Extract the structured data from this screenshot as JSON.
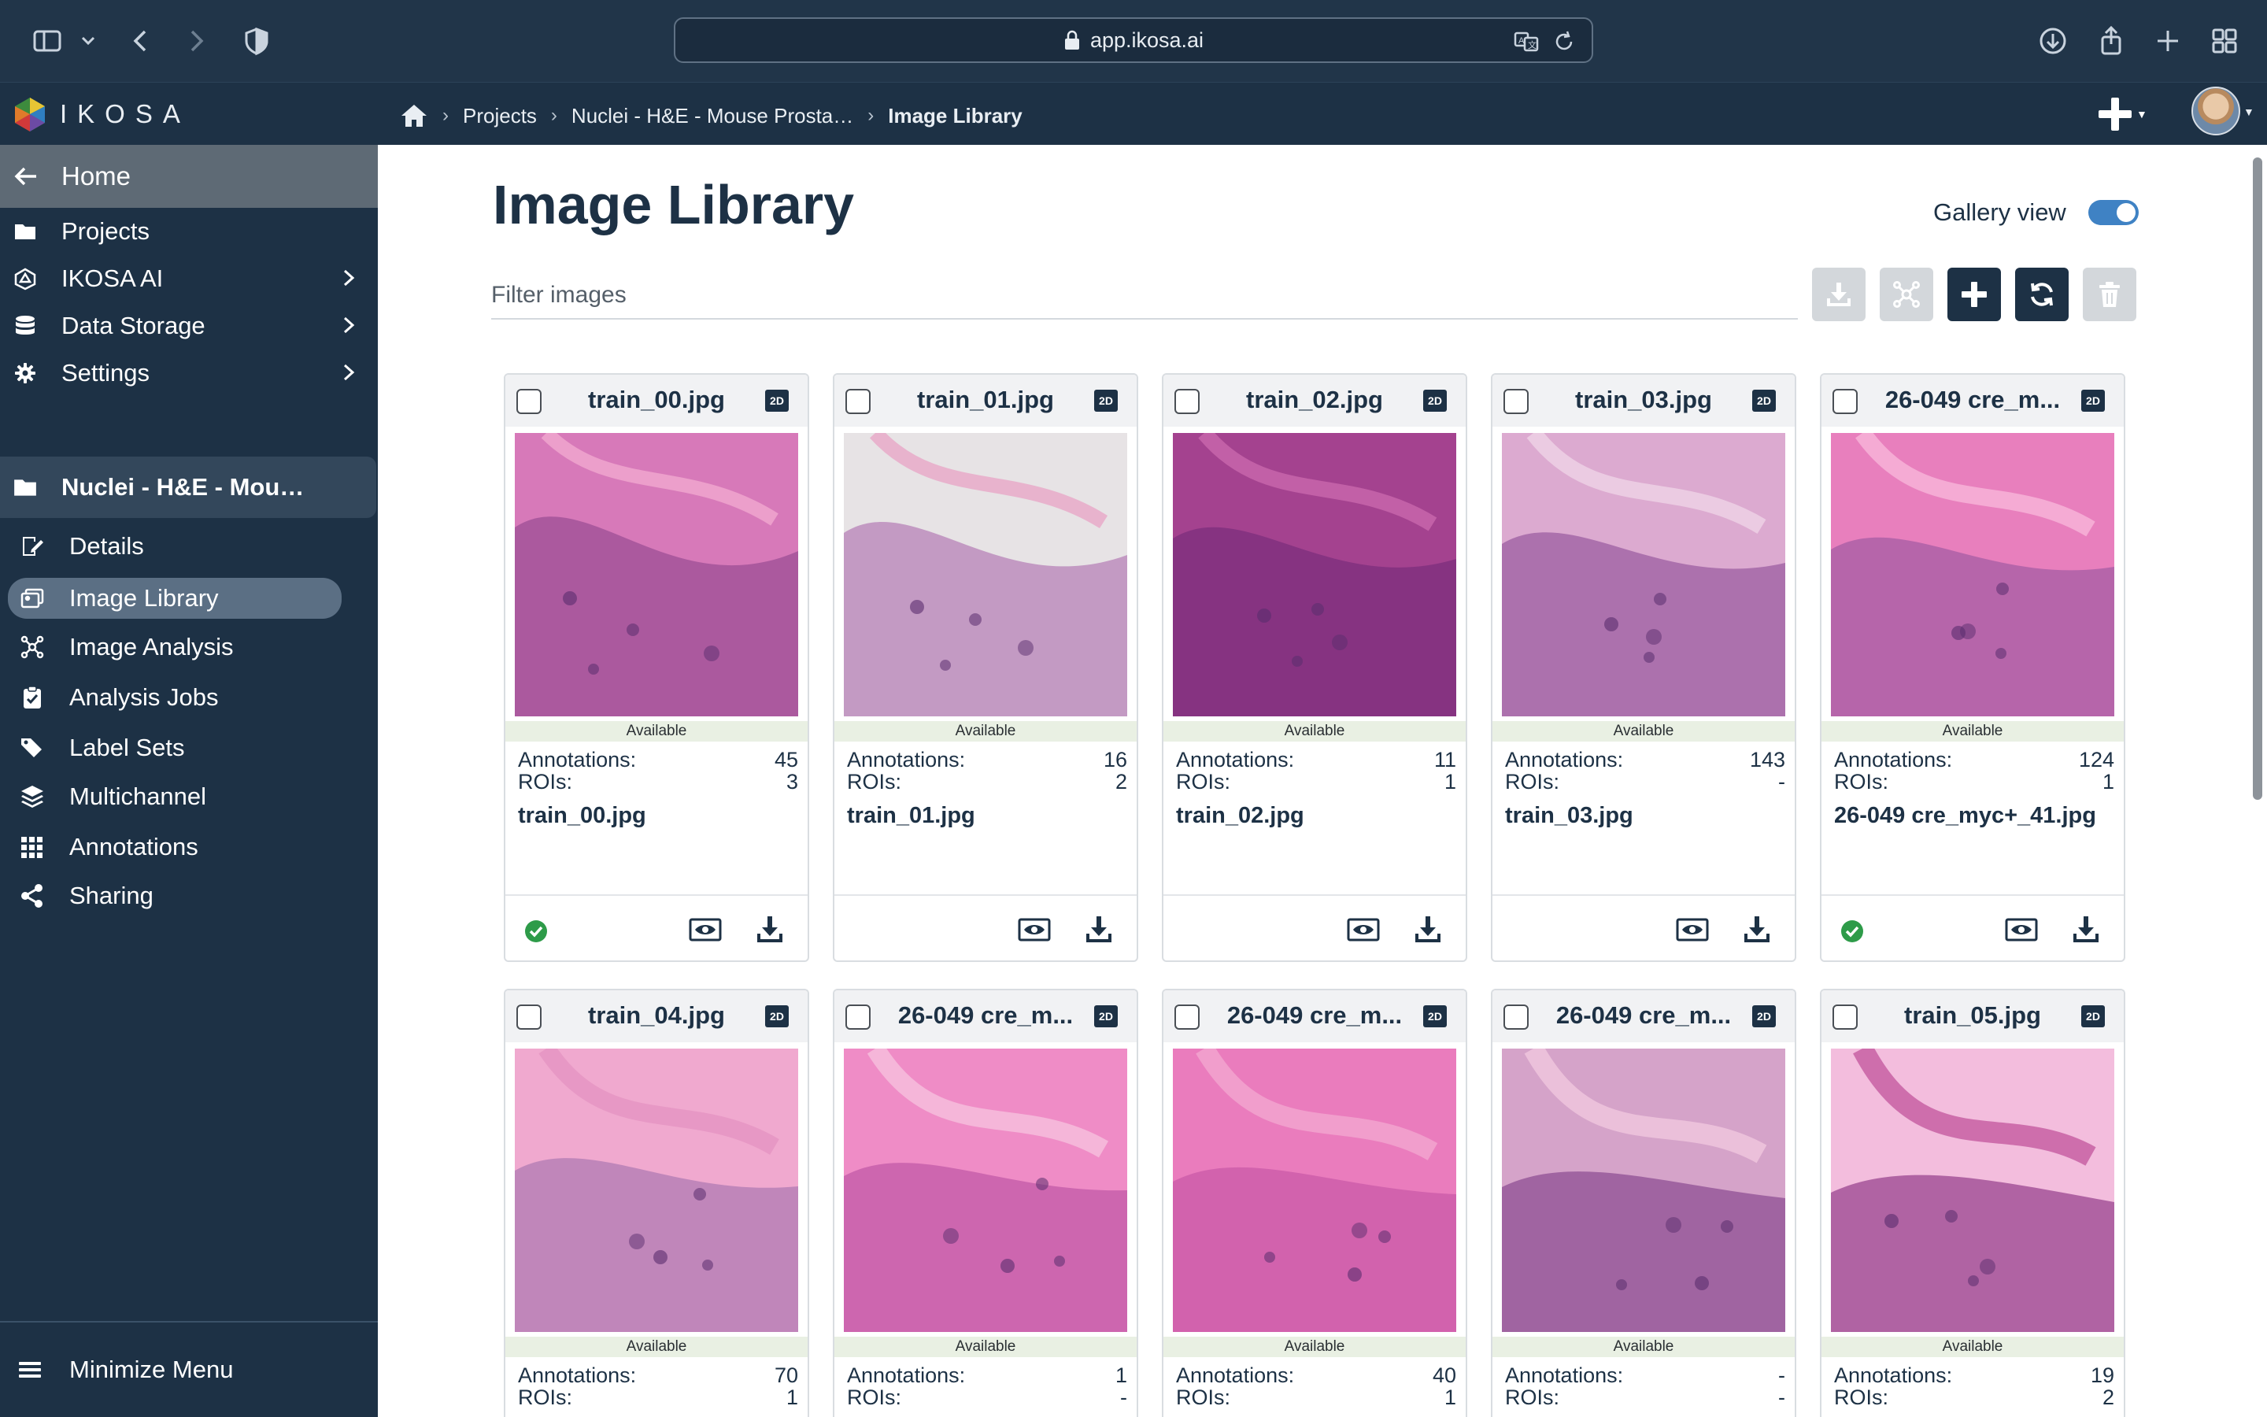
{
  "browser": {
    "url": "app.ikosa.ai"
  },
  "header": {
    "logo_text": "IKOSA",
    "breadcrumb": {
      "projects": "Projects",
      "project": "Nuclei - H&E - Mouse Prosta…",
      "current": "Image Library"
    }
  },
  "sidebar": {
    "home": "Home",
    "items": [
      {
        "label": "Projects",
        "icon": "folder-icon"
      },
      {
        "label": "IKOSA AI",
        "icon": "ai-icon"
      },
      {
        "label": "Data Storage",
        "icon": "database-icon"
      },
      {
        "label": "Settings",
        "icon": "gear-icon"
      }
    ],
    "project_name": "Nuclei - H&E - Mou…",
    "project_items": [
      {
        "label": "Details",
        "icon": "edit-icon"
      },
      {
        "label": "Image Library",
        "icon": "images-icon"
      },
      {
        "label": "Image Analysis",
        "icon": "analysis-icon"
      },
      {
        "label": "Analysis Jobs",
        "icon": "clipboard-check-icon"
      },
      {
        "label": "Label Sets",
        "icon": "tags-icon"
      },
      {
        "label": "Multichannel",
        "icon": "layers-icon"
      },
      {
        "label": "Annotations",
        "icon": "grid-icon"
      },
      {
        "label": "Sharing",
        "icon": "share-icon"
      }
    ],
    "minimize": "Minimize Menu"
  },
  "main": {
    "title": "Image Library",
    "gallery_view_label": "Gallery view",
    "gallery_view_on": true,
    "filter_placeholder": "Filter images",
    "annotations_label": "Annotations:",
    "rois_label": "ROIs:",
    "badge": "2D",
    "status": "Available",
    "accent_color": "#3f82c4",
    "cards": [
      {
        "title": "train_00.jpg",
        "annotations": "45",
        "rois": "3",
        "name": "train_00.jpg",
        "verified": true
      },
      {
        "title": "train_01.jpg",
        "annotations": "16",
        "rois": "2",
        "name": "train_01.jpg",
        "verified": false
      },
      {
        "title": "train_02.jpg",
        "annotations": "11",
        "rois": "1",
        "name": "train_02.jpg",
        "verified": false
      },
      {
        "title": "train_03.jpg",
        "annotations": "143",
        "rois": "-",
        "name": "train_03.jpg",
        "verified": false
      },
      {
        "title": "26-049 cre_m...",
        "annotations": "124",
        "rois": "1",
        "name": "26-049 cre_myc+_41.jpg",
        "verified": true
      },
      {
        "title": "train_04.jpg",
        "annotations": "70",
        "rois": "1"
      },
      {
        "title": "26-049 cre_m...",
        "annotations": "1",
        "rois": "-"
      },
      {
        "title": "26-049 cre_m...",
        "annotations": "40",
        "rois": "1"
      },
      {
        "title": "26-049 cre_m...",
        "annotations": "-",
        "rois": "-"
      },
      {
        "title": "train_05.jpg",
        "annotations": "19",
        "rois": "2"
      }
    ]
  }
}
